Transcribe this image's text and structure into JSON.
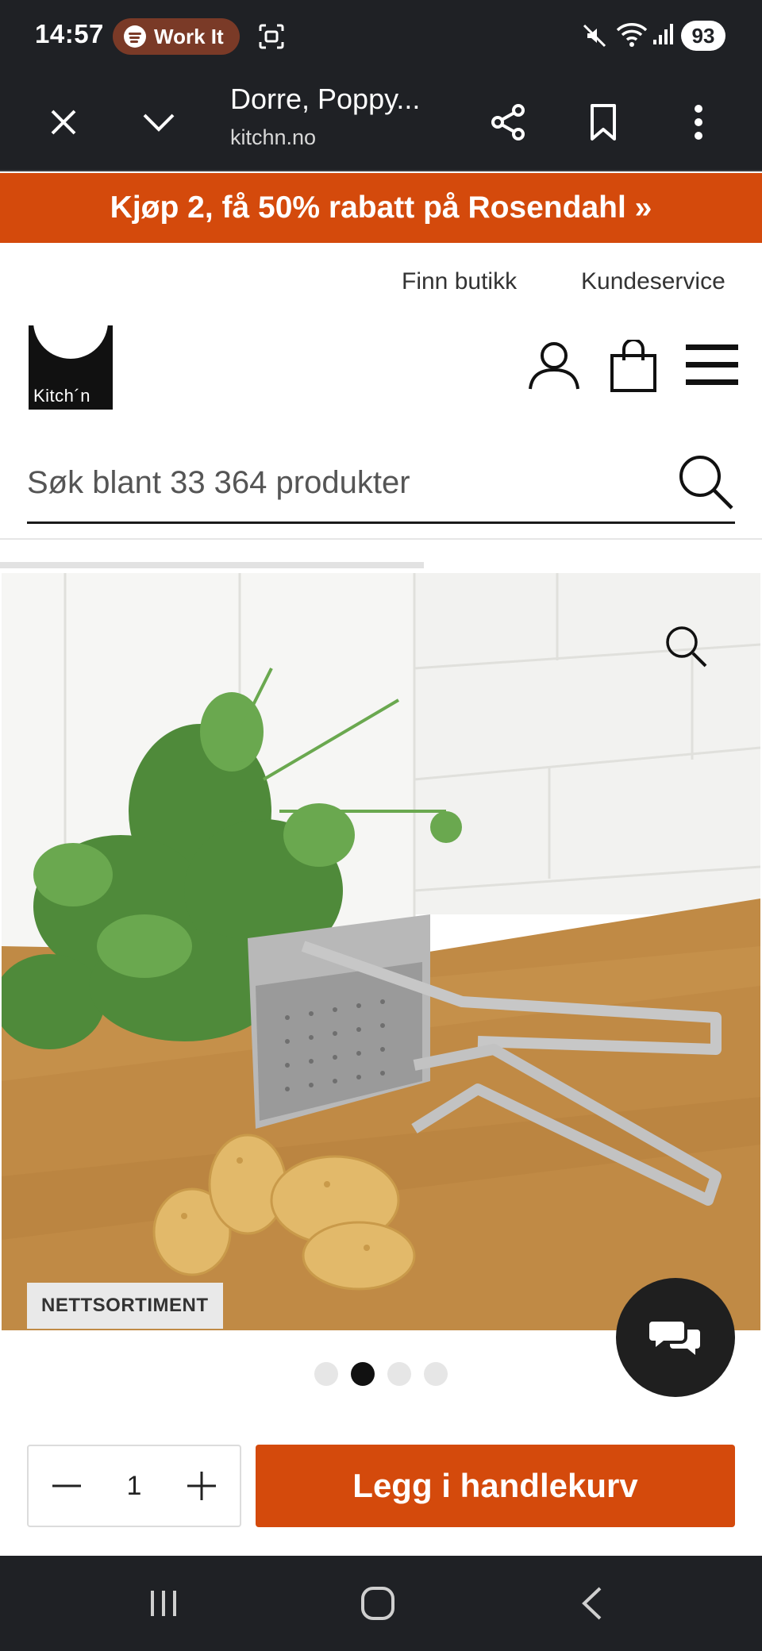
{
  "status_bar": {
    "time": "14:57",
    "spotify_label": "Work It",
    "battery": "93",
    "icons": [
      "spotify-icon",
      "screen-record-icon",
      "mute-icon",
      "wifi-icon",
      "signal-icon"
    ]
  },
  "toolbar": {
    "title": "Dorre, Poppy...",
    "url": "kitchn.no",
    "icons": [
      "close-icon",
      "chevron-down-icon",
      "share-icon",
      "bookmark-icon",
      "more-vertical-icon"
    ]
  },
  "promo": {
    "text": "Kjøp 2, få 50% rabatt på Rosendahl »",
    "color": "#d44a0c"
  },
  "header": {
    "links": [
      "Finn butikk",
      "Kundeservice"
    ],
    "logo_text": "Kitch´n",
    "icons": [
      "account-icon",
      "shopping-bag-icon",
      "menu-icon"
    ]
  },
  "search": {
    "placeholder": "Søk blant 33 364 produkter"
  },
  "product": {
    "badge": "NETTSORTIMENT",
    "image_count": 4,
    "active_image": 2
  },
  "cart": {
    "quantity": "1",
    "add_label": "Legg i handlekurv"
  },
  "navbar": {
    "icons": [
      "recent-apps-icon",
      "home-icon",
      "back-icon"
    ]
  }
}
